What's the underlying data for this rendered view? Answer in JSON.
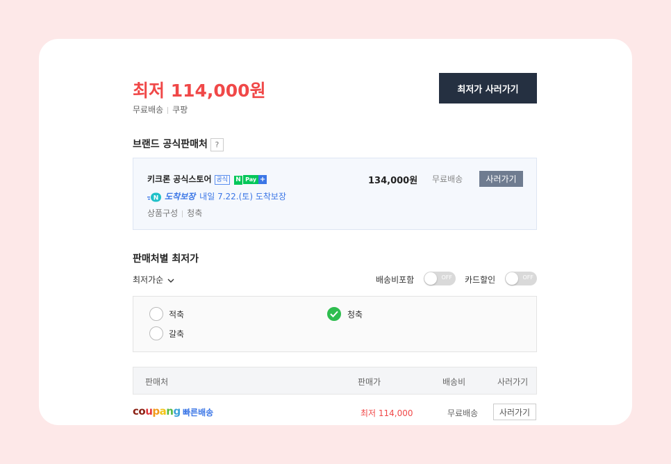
{
  "summary": {
    "price_title": "최저 114,000원",
    "shipping": "무료배송",
    "seller": "쿠팡",
    "buy_lowest_label": "최저가 사러가기"
  },
  "brand": {
    "section_title": "브랜드 공식판매처",
    "help_label": "?",
    "store_name": "키크론 공식스토어",
    "official_badge": "공식",
    "npay_n": "N",
    "npay_text": "Pay",
    "npay_plus": "+",
    "delivery_badge": "도착보장",
    "delivery_text": "내일 7.22.(토) 도착보장",
    "composition_label": "상품구성",
    "composition_value": "청축",
    "price": "134,000원",
    "shipping": "무료배송",
    "buy_label": "사러가기"
  },
  "sellers": {
    "section_title": "판매처별 최저가",
    "sort_label": "최저가순",
    "toggles": [
      {
        "label": "배송비포함",
        "state": "OFF"
      },
      {
        "label": "카드할인",
        "state": "OFF"
      }
    ],
    "options": [
      {
        "label": "적축",
        "checked": false
      },
      {
        "label": "갈축",
        "checked": false
      },
      {
        "label": "청축",
        "checked": true
      }
    ],
    "columns": [
      "판매처",
      "판매가",
      "배송비",
      "사러가기"
    ],
    "rows": [
      {
        "seller_logo_letters": [
          "c",
          "o",
          "u",
          "p",
          "a",
          "n",
          "g"
        ],
        "badge": "빠른배송",
        "price": "최저 114,000",
        "shipping": "무료배송",
        "buy_label": "사러가기"
      }
    ]
  },
  "colors": {
    "accent_red": "#f04848",
    "dark_button": "#253041",
    "link_blue": "#3b76e6",
    "check_green": "#2ebd4f"
  }
}
